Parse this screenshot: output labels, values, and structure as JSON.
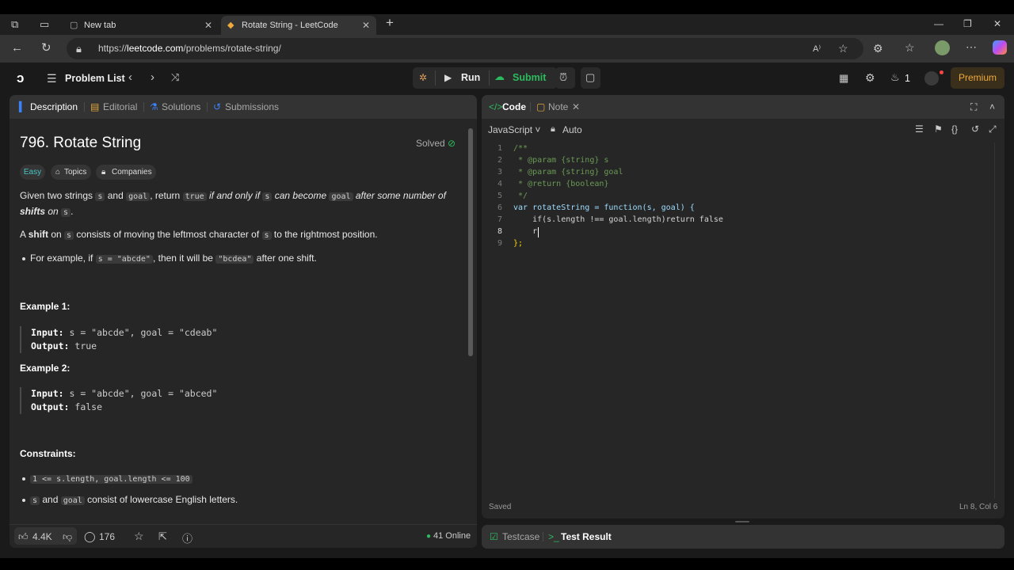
{
  "browser": {
    "tabs": [
      {
        "title": "New tab"
      },
      {
        "title": "Rotate String - LeetCode"
      }
    ],
    "new_tab_symbol": "+",
    "url_prefix": "https://",
    "url_host": "leetcode.com",
    "url_path": "/problems/rotate-string/"
  },
  "lc_nav": {
    "problem_list": "Problem List",
    "run": "Run",
    "submit": "Submit",
    "streak_count": "1",
    "premium": "Premium"
  },
  "left_tabs": [
    "Description",
    "Editorial",
    "Solutions",
    "Submissions"
  ],
  "problem": {
    "title": "796. Rotate String",
    "status": "Solved",
    "difficulty": "Easy",
    "topics": "Topics",
    "companies": "Companies",
    "p1": [
      "Given two strings ",
      "s",
      " and ",
      "goal",
      ", return ",
      "true",
      " if and only if ",
      "s",
      " can become ",
      "goal",
      " after some number of ",
      "shifts",
      " on ",
      "s",
      "."
    ],
    "p2": [
      "A ",
      "shift",
      " on ",
      "s",
      " consists of moving the leftmost character of ",
      "s",
      " to the rightmost position."
    ],
    "bullet": [
      "For example, if ",
      "s = \"abcde\"",
      ", then it will be ",
      "\"bcdea\"",
      " after one shift."
    ],
    "example1_heading": "Example 1:",
    "example1_input_label": "Input:",
    "example1_input": " s = \"abcde\", goal = \"cdeab\"",
    "example1_output_label": "Output:",
    "example1_output": " true",
    "example2_heading": "Example 2:",
    "example2_input_label": "Input:",
    "example2_input": " s = \"abcde\", goal = \"abced\"",
    "example2_output_label": "Output:",
    "example2_output": " false",
    "constraints_heading": "Constraints:",
    "constraint1": "1 <= s.length, goal.length <= 100",
    "constraint2": [
      "s",
      " and ",
      "goal",
      " consist of lowercase English letters."
    ]
  },
  "footer_left": {
    "likes": "4.4K",
    "comments": "176",
    "online": "41 Online"
  },
  "editor": {
    "tab_code": "Code",
    "tab_note": "Note",
    "language": "JavaScript",
    "auto": "Auto",
    "lines": [
      "/**",
      " * @param {string} s",
      " * @param {string} goal",
      " * @return {boolean}",
      " */",
      "var rotateString = function(s, goal) {",
      "    if(s.length !== goal.length)return false",
      "    r",
      "};"
    ],
    "saved": "Saved",
    "cursor_pos": "Ln 8, Col 6"
  },
  "bottom_tabs": {
    "testcase": "Testcase",
    "test_result": "Test Result"
  },
  "colors": {
    "accent_orange": "#f0a93b",
    "green": "#2cbb5d",
    "easy": "#46c6c2",
    "blue": "#3b82f6"
  }
}
